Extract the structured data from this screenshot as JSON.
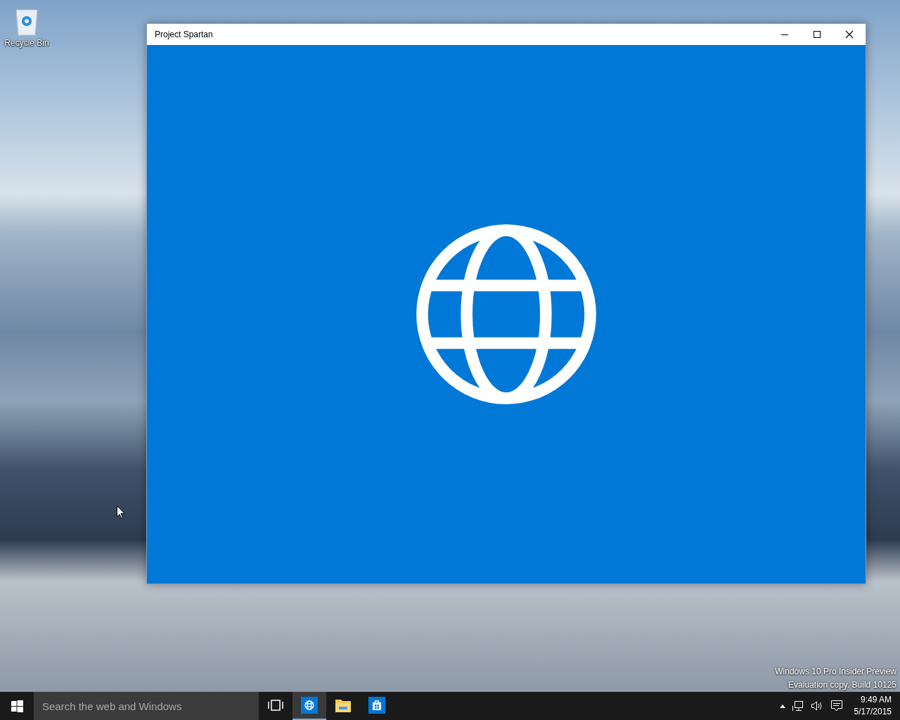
{
  "desktop": {
    "icons": [
      {
        "kind": "recycle-bin",
        "label": "Recycle Bin"
      }
    ],
    "evaluation_notice": [
      "Windows 10 Pro Insider Preview",
      "Evaluation copy. Build 10125"
    ]
  },
  "window": {
    "title": "Project Spartan"
  },
  "taskbar": {
    "search": {
      "placeholder": "Search the web and Windows"
    },
    "apps": [
      {
        "kind": "browser",
        "selected": true
      },
      {
        "kind": "explorer",
        "selected": false
      },
      {
        "kind": "store",
        "selected": false
      }
    ],
    "clock": {
      "time": "9:49 AM",
      "date": "5/17/2015"
    }
  }
}
